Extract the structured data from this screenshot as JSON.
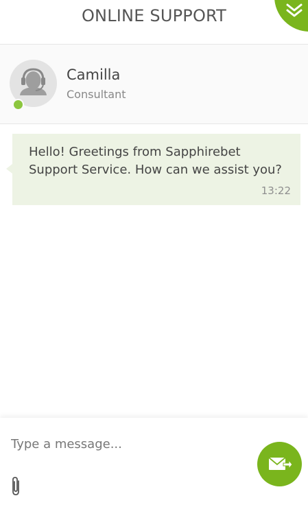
{
  "header": {
    "title": "ONLINE SUPPORT",
    "collapse_icon": "double-chevron-down-icon"
  },
  "agent": {
    "name": "Camilla",
    "role": "Consultant",
    "status": "online",
    "avatar_icon": "support-agent-headset-icon"
  },
  "messages": [
    {
      "text": "Hello! Greetings from Sapphirebet Support Service. How can we assist you?",
      "time": "13:22"
    }
  ],
  "composer": {
    "placeholder": "Type a message...",
    "value": "",
    "attach_icon": "paperclip-icon",
    "send_icon": "send-envelope-icon"
  },
  "colors": {
    "accent": "#7ab51d",
    "online": "#8cc63f",
    "bubble": "#edf3e4"
  }
}
